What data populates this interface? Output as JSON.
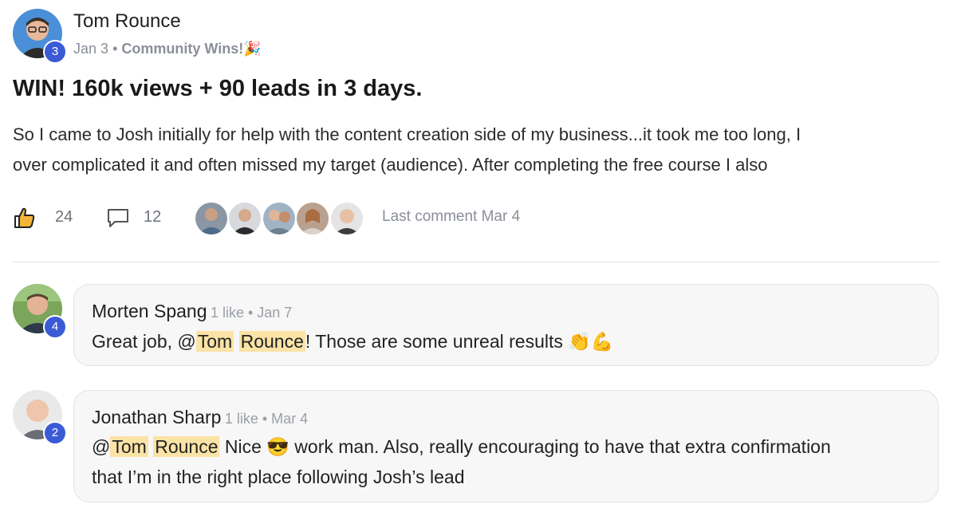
{
  "post": {
    "author": "Tom Rounce",
    "author_level": "3",
    "date": "Jan 3",
    "separator": "•",
    "category": "Community Wins!🎉",
    "title": "WIN! 160k views + 90 leads in 3 days.",
    "body_line1": "So I came to Josh initially for help with the content creation side of my business...it took me too long, I",
    "body_line2": "over complicated it and often missed my target (audience). After completing the free course I also",
    "likes": "24",
    "comments": "12",
    "last_comment": "Last comment Mar 4",
    "icons": {
      "like": "thumbs-up-icon",
      "comment": "comment-bubble-icon"
    }
  },
  "comments": [
    {
      "author": "Morten Spang",
      "level": "4",
      "meta": "1 like • Jan 7",
      "text_before": "Great job, @",
      "mention_first": "Tom",
      "mention_last": "Rounce",
      "text_after": "! Those are some unreal results 👏💪"
    },
    {
      "author": "Jonathan Sharp",
      "level": "2",
      "meta": "1 like • Mar 4",
      "text_before": "@",
      "mention_first": "Tom",
      "mention_last": "Rounce",
      "text_after": " Nice 😎 work man. Also, really encouraging to have that extra confirmation",
      "text_line2": "that I’m in the right place following Josh’s lead"
    }
  ],
  "colors": {
    "level_badge": "#3b5bd6",
    "mention_highlight": "#fbe3a6"
  }
}
